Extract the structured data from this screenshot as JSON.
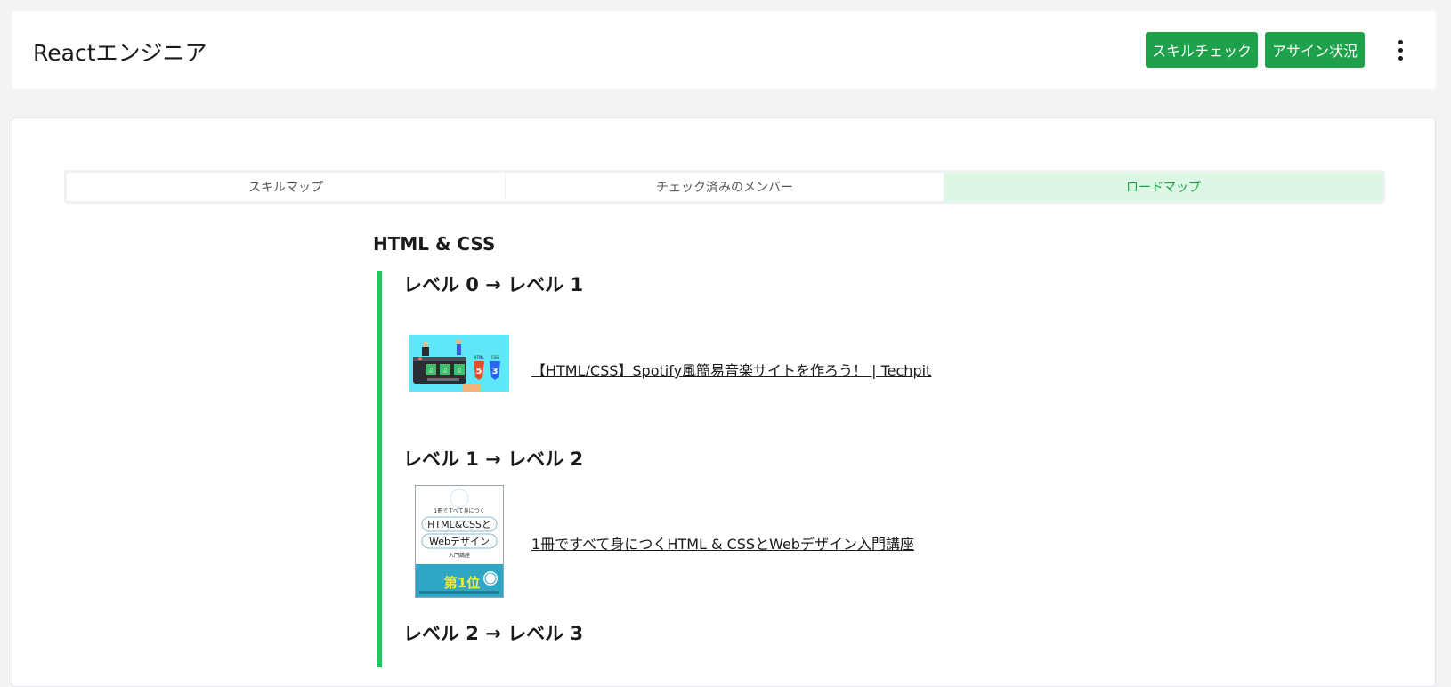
{
  "header": {
    "title": "Reactエンジニア",
    "buttons": {
      "skill_check": "スキルチェック",
      "assign_status": "アサイン状況"
    },
    "menu_icon": "more-vertical-icon"
  },
  "tabs": [
    {
      "label": "スキルマップ",
      "active": false
    },
    {
      "label": "チェック済みのメンバー",
      "active": false
    },
    {
      "label": "ロードマップ",
      "active": true
    }
  ],
  "roadmap": {
    "section_title": "HTML & CSS",
    "levels": [
      {
        "title": "レベル 0 → レベル 1",
        "resources": [
          {
            "link_text": "【HTML/CSS】Spotify風簡易音楽サイトを作ろう！ | Techpit",
            "thumbnail": "spotify-course-thumbnail"
          }
        ]
      },
      {
        "title": "レベル 1 → レベル 2",
        "resources": [
          {
            "link_text": "1冊ですべて身につくHTML & CSSとWebデザイン入門講座",
            "thumbnail": "html-css-book-cover"
          }
        ]
      },
      {
        "title": "レベル 2 → レベル 3",
        "resources": []
      }
    ]
  },
  "thumbnails": {
    "book": {
      "top_text": "1冊ですべて身につく",
      "line1": "HTML&CSSと",
      "line2": "Webデザイン",
      "line3": "入門講座",
      "badge": "第1位"
    },
    "course": {
      "html_label": "HTML",
      "css_label": "CSS"
    }
  },
  "colors": {
    "accent": "#1fa04a",
    "active_tab_bg": "#dcf8e5",
    "roadmap_line": "#23c55e"
  }
}
